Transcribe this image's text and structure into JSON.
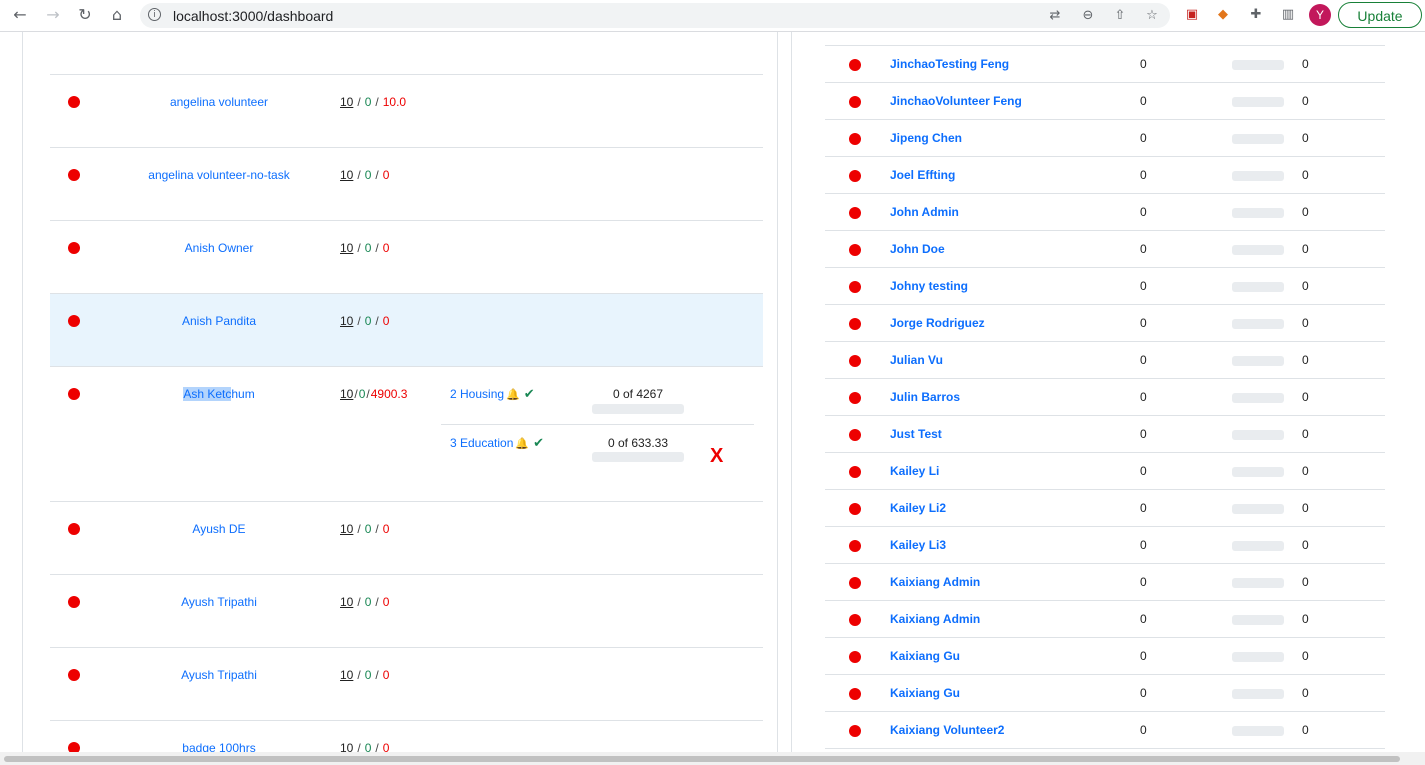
{
  "browser": {
    "url": "localhost:3000/dashboard",
    "avatar_letter": "Y",
    "update_label": "Update"
  },
  "left_table": {
    "rows": [
      {
        "name": "angelina volunteer",
        "target": "10",
        "done": "0",
        "remaining": "10.0"
      },
      {
        "name": "angelina volunteer-no-task",
        "target": "10",
        "done": "0",
        "remaining": "0"
      },
      {
        "name": "Anish Owner",
        "target": "10",
        "done": "0",
        "remaining": "0"
      },
      {
        "name": "Anish Pandita",
        "target": "10",
        "done": "0",
        "remaining": "0"
      },
      {
        "name_selected": "Ash Ketc",
        "name_rest": "hum",
        "target": "10",
        "done": "0",
        "remaining": "4900.3",
        "tasks": [
          {
            "label": "2 Housing",
            "progress": "0 of 4267"
          },
          {
            "label": "3 Education",
            "progress": "0 of 633.33"
          }
        ],
        "remove_label": "X"
      },
      {
        "name": "Ayush DE",
        "target": "10",
        "done": "0",
        "remaining": "0"
      },
      {
        "name": "Ayush Tripathi",
        "target": "10",
        "done": "0",
        "remaining": "0"
      },
      {
        "name": "Ayush Tripathi",
        "target": "10",
        "done": "0",
        "remaining": "0"
      },
      {
        "name": "badge 100hrs",
        "target": "10",
        "done": "0",
        "remaining": "0"
      }
    ],
    "separator": "/"
  },
  "right_table": {
    "rows": [
      {
        "name": "JinchaoTesting Feng",
        "value": "0",
        "value2": "0"
      },
      {
        "name": "JinchaoVolunteer Feng",
        "value": "0",
        "value2": "0"
      },
      {
        "name": "Jipeng Chen",
        "value": "0",
        "value2": "0"
      },
      {
        "name": "Joel Effting",
        "value": "0",
        "value2": "0"
      },
      {
        "name": "John Admin",
        "value": "0",
        "value2": "0"
      },
      {
        "name": "John Doe",
        "value": "0",
        "value2": "0"
      },
      {
        "name": "Johny testing",
        "value": "0",
        "value2": "0"
      },
      {
        "name": "Jorge Rodriguez",
        "value": "0",
        "value2": "0"
      },
      {
        "name": "Julian Vu",
        "value": "0",
        "value2": "0"
      },
      {
        "name": "Julin Barros",
        "value": "0",
        "value2": "0"
      },
      {
        "name": "Just Test",
        "value": "0",
        "value2": "0"
      },
      {
        "name": "Kailey Li",
        "value": "0",
        "value2": "0"
      },
      {
        "name": "Kailey Li2",
        "value": "0",
        "value2": "0"
      },
      {
        "name": "Kailey Li3",
        "value": "0",
        "value2": "0"
      },
      {
        "name": "Kaixiang Admin",
        "value": "0",
        "value2": "0"
      },
      {
        "name": "Kaixiang Admin",
        "value": "0",
        "value2": "0"
      },
      {
        "name": "Kaixiang Gu",
        "value": "0",
        "value2": "0"
      },
      {
        "name": "Kaixiang Gu",
        "value": "0",
        "value2": "0"
      },
      {
        "name": "Kaixiang Volunteer2",
        "value": "0",
        "value2": "0"
      }
    ]
  },
  "colors": {
    "status_dot": "#ed0000",
    "link": "#0d6efd",
    "done_green": "#198754",
    "remaining_red": "#ed0000",
    "active_row": "#e8f4fd"
  }
}
